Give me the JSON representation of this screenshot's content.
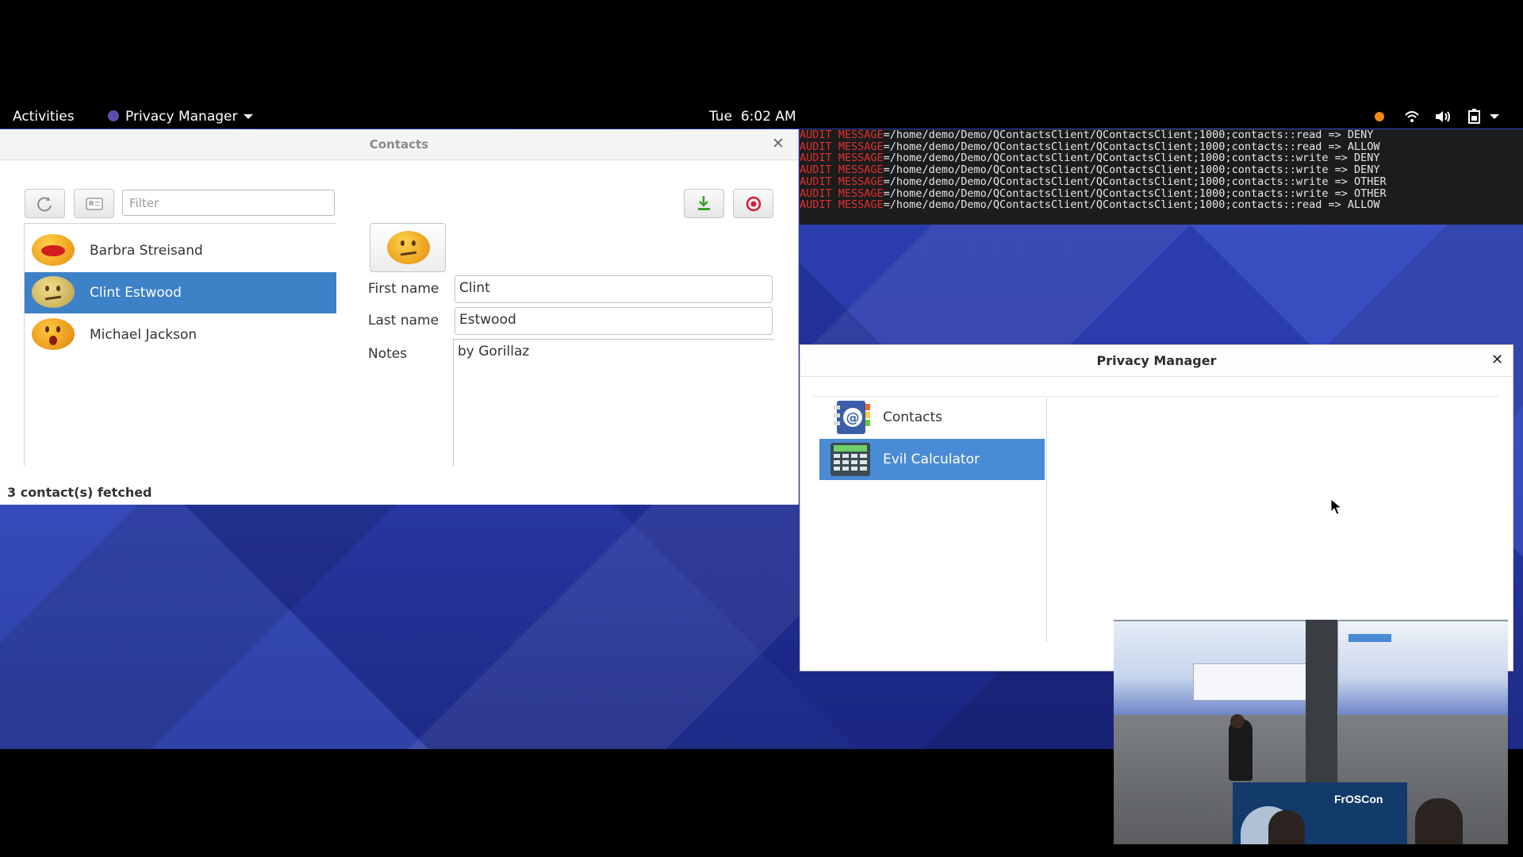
{
  "topbar": {
    "activities": "Activities",
    "app_menu": "Privacy Manager",
    "clock": "Tue  6:02 AM"
  },
  "contacts_window": {
    "title": "Contacts",
    "filter_placeholder": "Filter",
    "contacts": [
      {
        "name": "Barbra Streisand",
        "selected": false
      },
      {
        "name": "Clint Estwood",
        "selected": true
      },
      {
        "name": "Michael Jackson",
        "selected": false
      }
    ],
    "form": {
      "first_name_label": "First name",
      "first_name_value": "Clint",
      "last_name_label": "Last name",
      "last_name_value": "Estwood",
      "notes_label": "Notes",
      "notes_value": "by Gorillaz"
    },
    "status": "3 contact(s) fetched"
  },
  "terminal": {
    "lines": [
      {
        "tag": "AUDIT MESSAGE",
        "text": "=/home/demo/Demo/QContactsClient/QContactsClient;1000;contacts::read => DENY"
      },
      {
        "tag": "AUDIT MESSAGE",
        "text": "=/home/demo/Demo/QContactsClient/QContactsClient;1000;contacts::read => ALLOW"
      },
      {
        "tag": "AUDIT MESSAGE",
        "text": "=/home/demo/Demo/QContactsClient/QContactsClient;1000;contacts::write => DENY"
      },
      {
        "tag": "AUDIT MESSAGE",
        "text": "=/home/demo/Demo/QContactsClient/QContactsClient;1000;contacts::write => DENY"
      },
      {
        "tag": "AUDIT MESSAGE",
        "text": "=/home/demo/Demo/QContactsClient/QContactsClient;1000;contacts::write => OTHER"
      },
      {
        "tag": "AUDIT MESSAGE",
        "text": "=/home/demo/Demo/QContactsClient/QContactsClient;1000;contacts::write => OTHER"
      },
      {
        "tag": "AUDIT MESSAGE",
        "text": "=/home/demo/Demo/QContactsClient/QContactsClient;1000;contacts::read => ALLOW"
      }
    ]
  },
  "privacy_window": {
    "title": "Privacy Manager",
    "apps": [
      {
        "name": "Contacts",
        "icon": "address-book-icon",
        "selected": false
      },
      {
        "name": "Evil Calculator",
        "icon": "calculator-icon",
        "selected": true
      }
    ]
  },
  "camera_overlay": {
    "banner_text": "FrOSCon"
  },
  "colors": {
    "selection": "#3d81c7",
    "terminal_bg": "#1c1c1c",
    "audit_red": "#e02f2f",
    "wallpaper": "#2a3aa8"
  }
}
